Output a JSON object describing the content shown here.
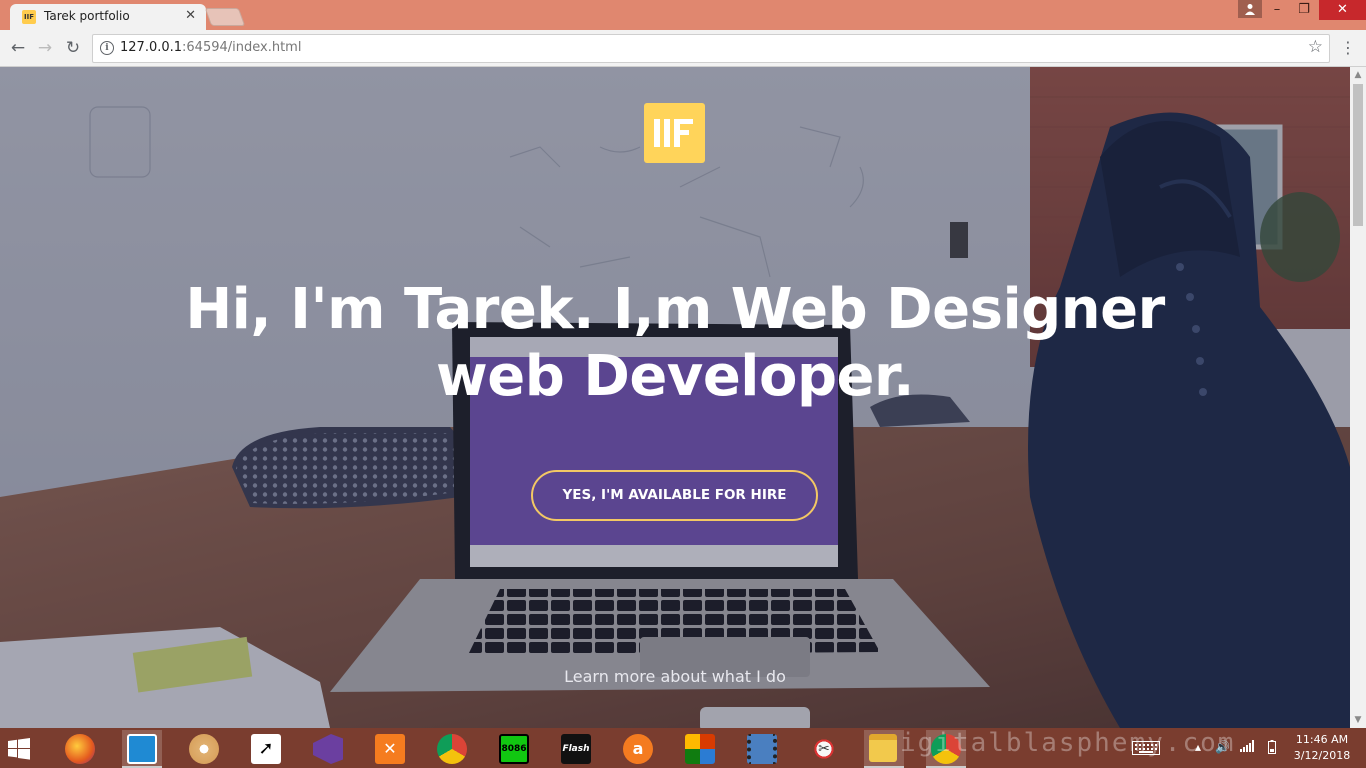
{
  "browser": {
    "tab_title": "Tarek portfolio",
    "favicon_text": "IIF",
    "url_host": "127.0.0.1",
    "url_rest": ":64594/index.html"
  },
  "hero": {
    "headline_line1": "Hi, I'm Tarek. I,m Web Designer",
    "headline_line2": "web Developer.",
    "cta_label": "YES, I'M AVAILABLE FOR HIRE",
    "learn_more": "Learn more about what I do",
    "accent_color": "#ffd45a"
  },
  "taskbar": {
    "apps": [
      "firefox-icon",
      "jetbrains-icon",
      "paint-icon",
      "cursor-tool-icon",
      "visual-studio-icon",
      "xampp-icon",
      "chrome-icon",
      "emu8086-icon",
      "flash-icon",
      "avast-icon",
      "office-icon",
      "video-icon",
      "snipping-tool-icon",
      "file-explorer-icon",
      "chrome-active-icon"
    ],
    "emu_label": "8086",
    "flash_label": "Flash",
    "watermark": "igitalblasphemy.com",
    "clock_time": "11:46 AM",
    "clock_date": "3/12/2018"
  }
}
